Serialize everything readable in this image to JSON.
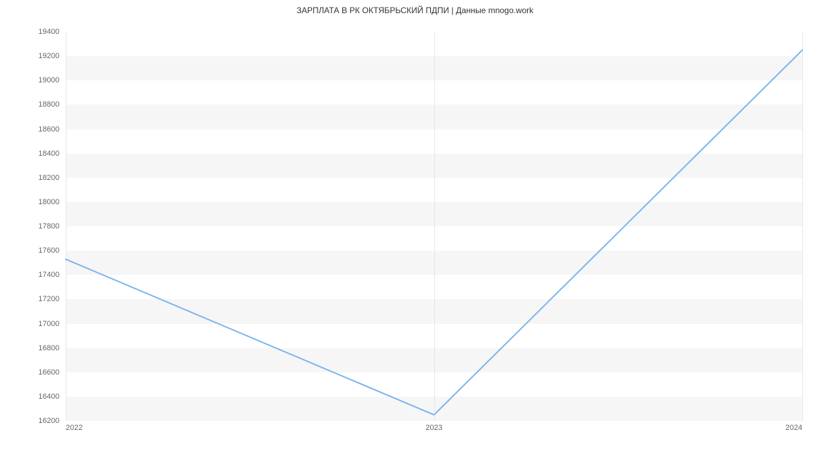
{
  "chart_data": {
    "type": "line",
    "title": "ЗАРПЛАТА В РК ОКТЯБРЬСКИЙ ПДПИ | Данные mnogo.work",
    "xlabel": "",
    "ylabel": "",
    "x": [
      2022,
      2023,
      2024
    ],
    "values": [
      17530,
      16250,
      19250
    ],
    "ylim": [
      16200,
      19400
    ],
    "y_ticks": [
      16200,
      16400,
      16600,
      16800,
      17000,
      17200,
      17400,
      17600,
      17800,
      18000,
      18200,
      18400,
      18600,
      18800,
      19000,
      19200,
      19400
    ],
    "x_ticks": [
      2022,
      2023,
      2024
    ],
    "line_color": "#7cb5ec",
    "plot_band_color": "#f6f6f6"
  }
}
